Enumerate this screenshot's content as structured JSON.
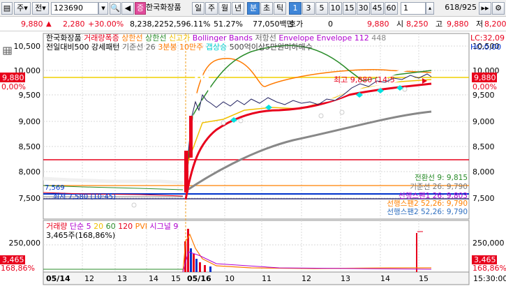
{
  "toolbar": {
    "mode1": "주",
    "mode2": "전",
    "code": "123690",
    "stock_name": "한국화장품",
    "periods": [
      "일",
      "주",
      "월",
      "년",
      "분",
      "초",
      "틱"
    ],
    "minute_options": [
      "1",
      "3",
      "5",
      "10",
      "15",
      "30",
      "45",
      "60"
    ],
    "selected_minute": "1",
    "count_value": "1",
    "page_info": "618/925"
  },
  "quote": {
    "price": "9,880",
    "change": "2,280",
    "change_pct": "+30.00%",
    "volume": "8,238,225",
    "volume_ratio": "2,596.11%",
    "turnover": "51.27%",
    "amount": "77,050백만",
    "hoga_label": "호가",
    "hoga_value": "0",
    "current": "9,880",
    "open_label": "시",
    "open": "8,250",
    "high_label": "고",
    "high": "9,880",
    "low_label": "저",
    "low": "8,200"
  },
  "legend": {
    "line1": [
      {
        "text": "한국화장품",
        "color": "#000000"
      },
      {
        "text": "거래량폭증",
        "color": "#e8001c"
      },
      {
        "text": "상한선",
        "color": "#ff7a00"
      },
      {
        "text": "상한선",
        "color": "#2a8c2a"
      },
      {
        "text": "신고가",
        "color": "#f0c000"
      },
      {
        "text": "Bollinger Bands",
        "color": "#b000d0"
      },
      {
        "text": "저항선",
        "color": "#666666"
      },
      {
        "text": "Envelope",
        "color": "#b000d0"
      },
      {
        "text": "Envelope 112",
        "color": "#b000d0"
      },
      {
        "text": "448",
        "color": "#888888"
      }
    ],
    "line2": [
      {
        "text": "전일대비500 강세패턴",
        "color": "#000000"
      },
      {
        "text": "기준선 26",
        "color": "#666666"
      },
      {
        "text": "3분봉 10만주",
        "color": "#ff7a00"
      },
      {
        "text": "갭상승",
        "color": "#00d0d0"
      },
      {
        "text": "500억이상5만원미하매수",
        "color": "#444444"
      }
    ],
    "lc": "LC:32,09",
    "hc": "HC:0,00"
  },
  "price_axis": {
    "ticks": [
      "10,500",
      "10,000",
      "9,500",
      "9,000",
      "8,500",
      "8,000",
      "7,500"
    ],
    "current_label": "9,880",
    "current_pct": "0,00%"
  },
  "annotations": {
    "high_label": "최고 9,880 (14:5",
    "low_label": "최저 7,580 (10:45)",
    "low_left_value": "7,569",
    "tenkan": "전환선 9: 9,815",
    "kijun": "기준선 26: 9,790",
    "span1": "선행스팬1 26: 9,803",
    "span2_up": "선행스팬2 52,26: 9,790",
    "span2": "선행스팬2 52,26: 9,790"
  },
  "volume_legend": {
    "items": [
      {
        "text": "거래량",
        "color": "#e8001c"
      },
      {
        "text": "단순 5",
        "color": "#b000d0"
      },
      {
        "text": "20",
        "color": "#f0c000"
      },
      {
        "text": "60",
        "color": "#2a8c2a"
      },
      {
        "text": "120",
        "color": "#e8001c"
      },
      {
        "text": "PVI",
        "color": "#ff7a00"
      },
      {
        "text": "시그널 9",
        "color": "#b000d0"
      }
    ],
    "current_volume": "3,465주(168,86%)",
    "axis_tick": "250,000",
    "current_label": "3,465",
    "current_pct": "168,86%"
  },
  "time_axis": {
    "labels": [
      "05/14",
      "12",
      "13",
      "14",
      "15",
      "05/16",
      "10",
      "11",
      "12",
      "13",
      "14",
      "15"
    ],
    "right_label": "15:30:00"
  },
  "colors": {
    "up": "#e8001c",
    "down": "#0033cc",
    "selected_button": "#3f86d8"
  }
}
